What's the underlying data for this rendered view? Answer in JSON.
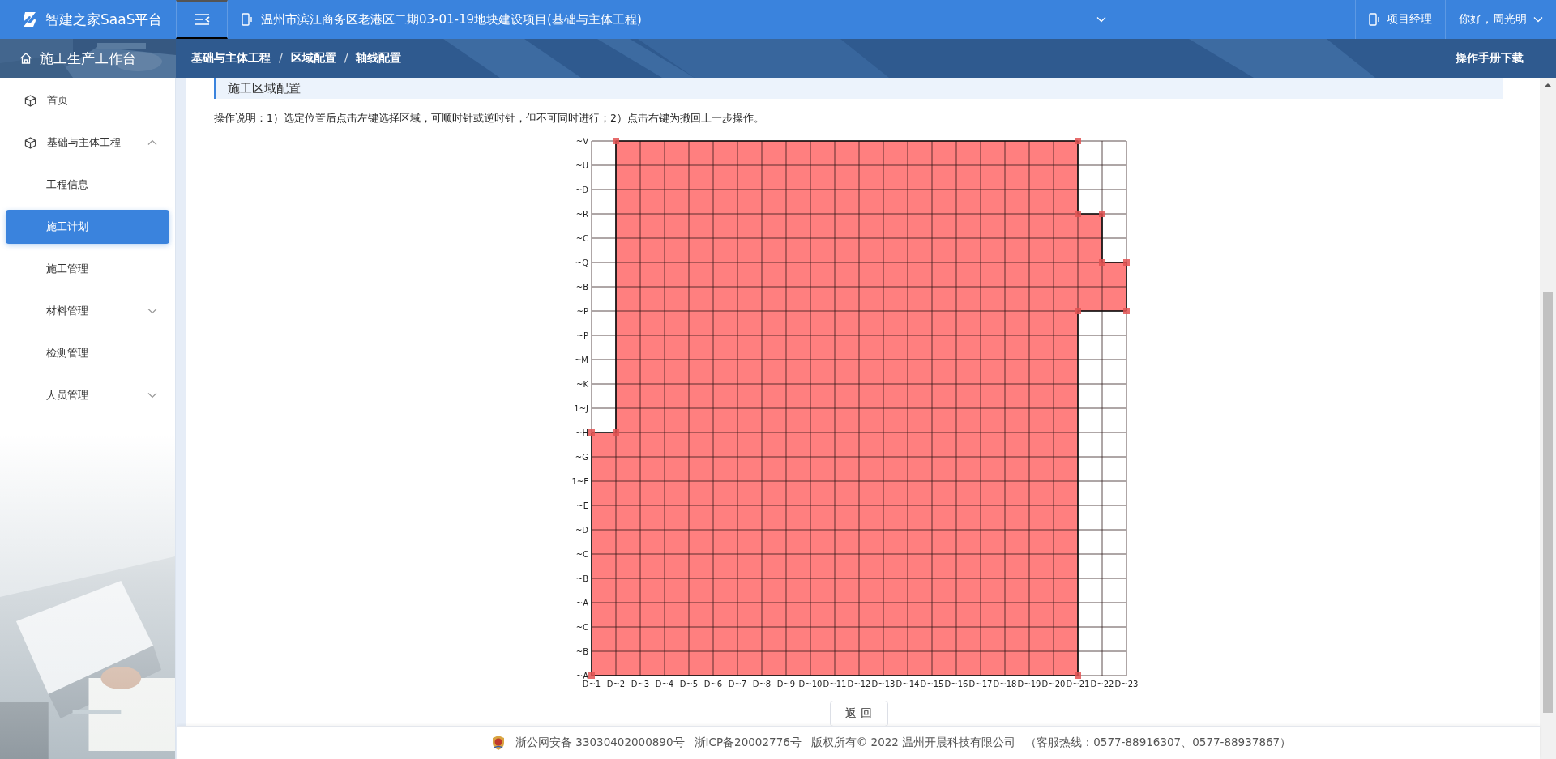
{
  "header": {
    "logo_text": "智建之家SaaS平台",
    "project": "温州市滨江商务区老港区二期03-01-19地块建设项目(基础与主体工程)",
    "role": "项目经理",
    "greeting": "你好，周光明"
  },
  "workbench": {
    "title": "施工生产工作台"
  },
  "breadcrumb": {
    "items": [
      "基础与主体工程",
      "区域配置",
      "轴线配置"
    ],
    "separators": [
      "/",
      "/"
    ]
  },
  "manual_link": "操作手册下载",
  "sidebar": {
    "items": [
      {
        "label": "首页",
        "selected": false
      },
      {
        "label": "基础与主体工程",
        "selected": false,
        "expanded": true,
        "children": [
          {
            "label": "工程信息",
            "selected": false
          },
          {
            "label": "施工计划",
            "selected": true
          },
          {
            "label": "施工管理",
            "selected": false
          },
          {
            "label": "材料管理",
            "selected": false,
            "expanded": false
          },
          {
            "label": "检测管理",
            "selected": false
          },
          {
            "label": "人员管理",
            "selected": false,
            "expanded": false
          }
        ]
      }
    ]
  },
  "section_title": "施工区域配置",
  "instructions": "操作说明：1）选定位置后点击左键选择区域，可顺时针或逆时针，但不可同时进行；2）点击右键为撤回上一步操作。",
  "grid": {
    "row_labels": [
      "~V",
      "~U",
      "~D",
      "~R",
      "~C",
      "~Q",
      "~B",
      "~P",
      "~P",
      "~M",
      "~K",
      "1~J",
      "~H",
      "~G",
      "1~F",
      "~E",
      "~D",
      "~C",
      "~B",
      "~A",
      "~C",
      "~B",
      "~A"
    ],
    "column_labels": [
      "D~1",
      "D~2",
      "D~3",
      "D~4",
      "D~5",
      "D~6",
      "D~7",
      "D~8",
      "D~9",
      "D~10",
      "D~11",
      "D~12",
      "D~13",
      "D~14",
      "D~15",
      "D~16",
      "D~17",
      "D~18",
      "D~19",
      "D~20",
      "D~21",
      "D~22",
      "D~23"
    ],
    "cells": [
      [
        false,
        true,
        true,
        true,
        true,
        true,
        true,
        true,
        true,
        true,
        true,
        true,
        true,
        true,
        true,
        true,
        true,
        true,
        true,
        true,
        false,
        false
      ],
      [
        false,
        true,
        true,
        true,
        true,
        true,
        true,
        true,
        true,
        true,
        true,
        true,
        true,
        true,
        true,
        true,
        true,
        true,
        true,
        true,
        false,
        false
      ],
      [
        false,
        true,
        true,
        true,
        true,
        true,
        true,
        true,
        true,
        true,
        true,
        true,
        true,
        true,
        true,
        true,
        true,
        true,
        true,
        true,
        false,
        false
      ],
      [
        false,
        true,
        true,
        true,
        true,
        true,
        true,
        true,
        true,
        true,
        true,
        true,
        true,
        true,
        true,
        true,
        true,
        true,
        true,
        true,
        true,
        false
      ],
      [
        false,
        true,
        true,
        true,
        true,
        true,
        true,
        true,
        true,
        true,
        true,
        true,
        true,
        true,
        true,
        true,
        true,
        true,
        true,
        true,
        true,
        false
      ],
      [
        false,
        true,
        true,
        true,
        true,
        true,
        true,
        true,
        true,
        true,
        true,
        true,
        true,
        true,
        true,
        true,
        true,
        true,
        true,
        true,
        true,
        true
      ],
      [
        false,
        true,
        true,
        true,
        true,
        true,
        true,
        true,
        true,
        true,
        true,
        true,
        true,
        true,
        true,
        true,
        true,
        true,
        true,
        true,
        true,
        true
      ],
      [
        false,
        true,
        true,
        true,
        true,
        true,
        true,
        true,
        true,
        true,
        true,
        true,
        true,
        true,
        true,
        true,
        true,
        true,
        true,
        true,
        false,
        false
      ],
      [
        false,
        true,
        true,
        true,
        true,
        true,
        true,
        true,
        true,
        true,
        true,
        true,
        true,
        true,
        true,
        true,
        true,
        true,
        true,
        true,
        false,
        false
      ],
      [
        false,
        true,
        true,
        true,
        true,
        true,
        true,
        true,
        true,
        true,
        true,
        true,
        true,
        true,
        true,
        true,
        true,
        true,
        true,
        true,
        false,
        false
      ],
      [
        false,
        true,
        true,
        true,
        true,
        true,
        true,
        true,
        true,
        true,
        true,
        true,
        true,
        true,
        true,
        true,
        true,
        true,
        true,
        true,
        false,
        false
      ],
      [
        false,
        true,
        true,
        true,
        true,
        true,
        true,
        true,
        true,
        true,
        true,
        true,
        true,
        true,
        true,
        true,
        true,
        true,
        true,
        true,
        false,
        false
      ],
      [
        true,
        true,
        true,
        true,
        true,
        true,
        true,
        true,
        true,
        true,
        true,
        true,
        true,
        true,
        true,
        true,
        true,
        true,
        true,
        true,
        false,
        false
      ],
      [
        true,
        true,
        true,
        true,
        true,
        true,
        true,
        true,
        true,
        true,
        true,
        true,
        true,
        true,
        true,
        true,
        true,
        true,
        true,
        true,
        false,
        false
      ],
      [
        true,
        true,
        true,
        true,
        true,
        true,
        true,
        true,
        true,
        true,
        true,
        true,
        true,
        true,
        true,
        true,
        true,
        true,
        true,
        true,
        false,
        false
      ],
      [
        true,
        true,
        true,
        true,
        true,
        true,
        true,
        true,
        true,
        true,
        true,
        true,
        true,
        true,
        true,
        true,
        true,
        true,
        true,
        true,
        false,
        false
      ],
      [
        true,
        true,
        true,
        true,
        true,
        true,
        true,
        true,
        true,
        true,
        true,
        true,
        true,
        true,
        true,
        true,
        true,
        true,
        true,
        true,
        false,
        false
      ],
      [
        true,
        true,
        true,
        true,
        true,
        true,
        true,
        true,
        true,
        true,
        true,
        true,
        true,
        true,
        true,
        true,
        true,
        true,
        true,
        true,
        false,
        false
      ],
      [
        true,
        true,
        true,
        true,
        true,
        true,
        true,
        true,
        true,
        true,
        true,
        true,
        true,
        true,
        true,
        true,
        true,
        true,
        true,
        true,
        false,
        false
      ],
      [
        true,
        true,
        true,
        true,
        true,
        true,
        true,
        true,
        true,
        true,
        true,
        true,
        true,
        true,
        true,
        true,
        true,
        true,
        true,
        true,
        false,
        false
      ],
      [
        true,
        true,
        true,
        true,
        true,
        true,
        true,
        true,
        true,
        true,
        true,
        true,
        true,
        true,
        true,
        true,
        true,
        true,
        true,
        true,
        false,
        false
      ],
      [
        true,
        true,
        true,
        true,
        true,
        true,
        true,
        true,
        true,
        true,
        true,
        true,
        true,
        true,
        true,
        true,
        true,
        true,
        true,
        true,
        false,
        false
      ]
    ]
  },
  "return_button": "返 回",
  "footer": {
    "police_record": "浙公网安备 33030402000890号",
    "icp": "浙ICP备20002776号",
    "copyright": "版权所有© 2022 温州开晨科技有限公司",
    "hotline": "（客服热线：0577-88916307、0577-88937867）"
  }
}
